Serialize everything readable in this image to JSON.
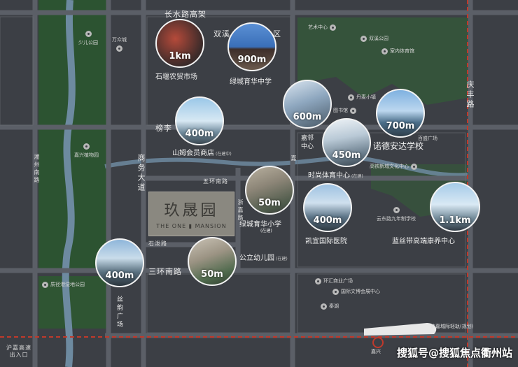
{
  "roads": {
    "changshui": "长水路高架",
    "shuangxi": "双溪",
    "district_suffix": "区",
    "bangsi": "榜李",
    "shangwu": "商务大道",
    "wuhuan": "五环南路",
    "shibo": "石泼路",
    "sanhuan": "三环南路",
    "qingfeng": "庆丰路",
    "tianzhou": "湘州南路",
    "hulan": "浙嘉路",
    "sijun": "丝韵广场",
    "qingchun_a": "嘉",
    "huhang_high": "沪嘉高速出入口",
    "hangzhou_rail": "沪嘉城际轻轨",
    "hangzhou_rail_note": "(规划)",
    "jiaxing_station_partial": "嘉兴"
  },
  "pois": [
    {
      "name": "少儿公园"
    },
    {
      "name": "万众城"
    },
    {
      "name": "艺术中心"
    },
    {
      "name": "双溪公园"
    },
    {
      "name": "室内体育馆"
    },
    {
      "name": "丹麦小镇"
    },
    {
      "name": "图书馆"
    },
    {
      "name": "嘉兴植物园"
    },
    {
      "name": "高铁新城文化中心"
    },
    {
      "name": "百盛广场"
    },
    {
      "name": "云东路九年制学校"
    },
    {
      "name": "质径港湿地公园"
    },
    {
      "name": "环汇商业广场"
    },
    {
      "name": "国际文博会展中心"
    },
    {
      "name": "秦湖"
    }
  ],
  "photos": [
    {
      "distance": "1km",
      "caption": "石堰农贸市场",
      "note": ""
    },
    {
      "distance": "900m",
      "caption": "绿城育华中学",
      "note": ""
    },
    {
      "distance": "600m",
      "caption": "",
      "note": ""
    },
    {
      "distance": "700m",
      "caption": "诺德安达学校",
      "note": ""
    },
    {
      "distance": "400m",
      "caption": "山姆会员商店",
      "note": "(在建中)"
    },
    {
      "distance": "450m",
      "caption": "时尚体育中心",
      "note": "(在建)"
    },
    {
      "distance": "50m",
      "caption": "绿城育华小学",
      "note": "(在建)"
    },
    {
      "distance": "400m",
      "caption": "凯宜国际医院",
      "note": ""
    },
    {
      "distance": "1.1km",
      "caption": "蓝丝带高端康养中心",
      "note": ""
    },
    {
      "distance": "400m",
      "caption": "",
      "note": ""
    },
    {
      "distance": "50m",
      "caption": "公立幼儿园",
      "note": "(在建)"
    }
  ],
  "jiaxing_center": "嘉邻中心",
  "project": {
    "name_cn": "玖晟园",
    "name_en": "THE ONE ▮ MANSION"
  },
  "watermark": "搜狐号@搜狐焦点衢州站",
  "colors": {
    "background": "#3c3f45",
    "road": "#5a5e66",
    "forest": "#2f5a35",
    "river": "#6f8fa6",
    "rail": "#c0392b"
  }
}
